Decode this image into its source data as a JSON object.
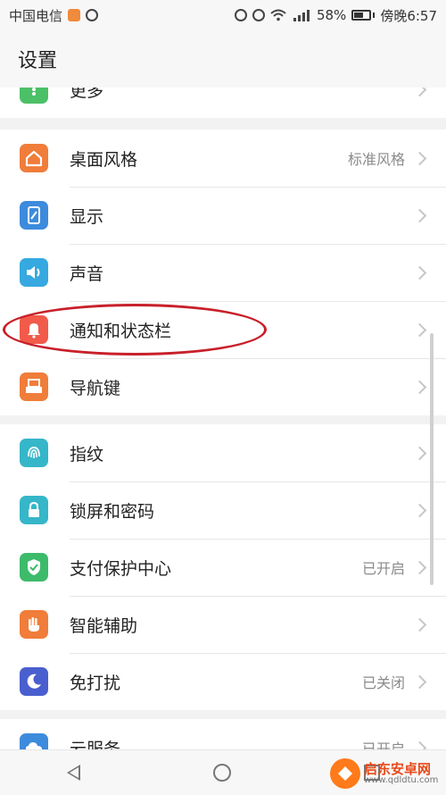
{
  "status_bar": {
    "carrier": "中国电信",
    "battery_percent": "58%",
    "time": "傍晚6:57"
  },
  "header": {
    "title": "设置"
  },
  "groups": [
    {
      "items": [
        {
          "label": "更多",
          "icon": "more-icon",
          "color": "#4cc067"
        }
      ]
    },
    {
      "items": [
        {
          "label": "桌面风格",
          "value": "标准风格",
          "icon": "home-icon",
          "color": "#f07d3a"
        },
        {
          "label": "显示",
          "value": "",
          "icon": "display-icon",
          "color": "#3d8bdd"
        },
        {
          "label": "声音",
          "value": "",
          "icon": "sound-icon",
          "color": "#36a9e1"
        },
        {
          "label": "通知和状态栏",
          "value": "",
          "icon": "bell-icon",
          "color": "#f25a4a"
        },
        {
          "label": "导航键",
          "value": "",
          "icon": "navkey-icon",
          "color": "#f07d3a"
        }
      ]
    },
    {
      "items": [
        {
          "label": "指纹",
          "value": "",
          "icon": "fingerprint-icon",
          "color": "#36b6c9"
        },
        {
          "label": "锁屏和密码",
          "value": "",
          "icon": "lock-icon",
          "color": "#36b6c9"
        },
        {
          "label": "支付保护中心",
          "value": "已开启",
          "icon": "shield-icon",
          "color": "#3dbb6a"
        },
        {
          "label": "智能辅助",
          "value": "",
          "icon": "hand-icon",
          "color": "#f07d3a"
        },
        {
          "label": "免打扰",
          "value": "已关闭",
          "icon": "moon-icon",
          "color": "#4a5fcf"
        }
      ]
    },
    {
      "items": [
        {
          "label": "云服务",
          "value": "已开启",
          "icon": "cloud-icon",
          "color": "#3d8bdd"
        }
      ]
    }
  ],
  "watermark": {
    "title": "启东安卓网",
    "url": "www.qdldtu.com"
  }
}
